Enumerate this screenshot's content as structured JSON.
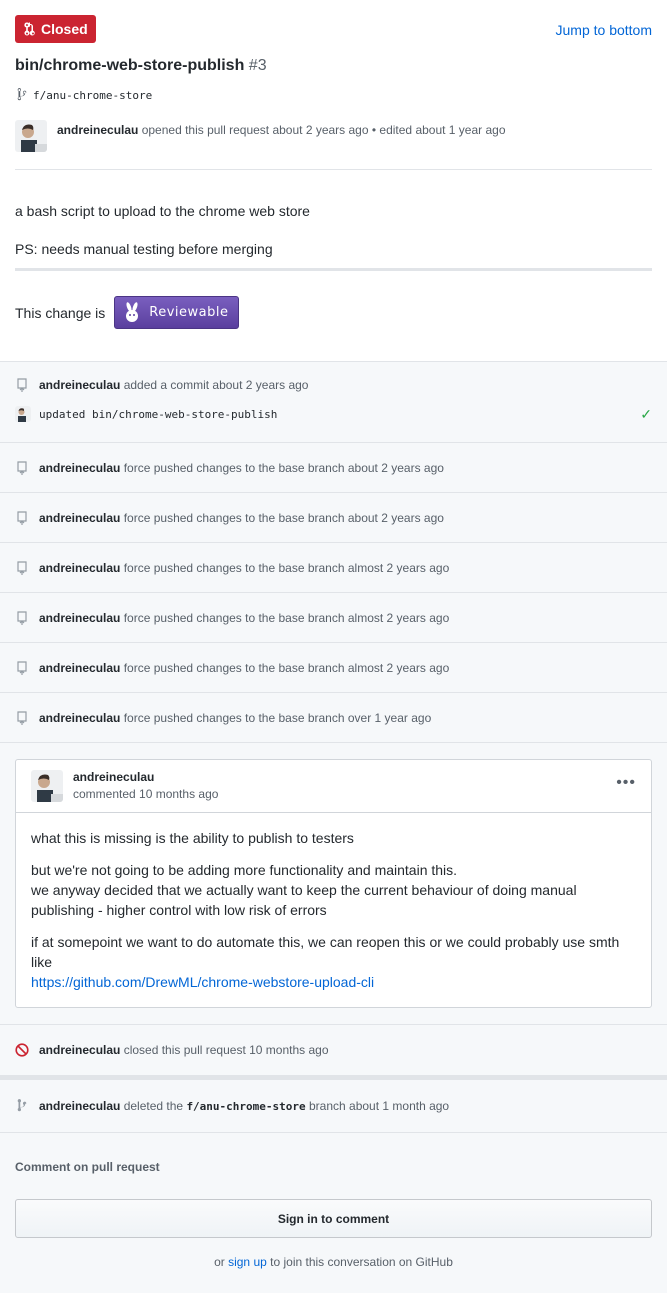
{
  "header": {
    "state_label": "Closed",
    "jump_label": "Jump to bottom",
    "title": "bin/chrome-web-store-publish",
    "number": "#3",
    "branch": "f/anu-chrome-store",
    "author": "andreineculau",
    "opened_text": "opened this pull request about 2 years ago",
    "edited_text": "• edited about 1 year ago"
  },
  "body": {
    "line1": "a bash script to upload to the chrome web store",
    "line2": "PS: needs manual testing before merging",
    "review_prefix": "This change is",
    "reviewable_label": "Reviewable"
  },
  "timeline": {
    "commit_event": {
      "author": "andreineculau",
      "text": "added a commit about 2 years ago",
      "commit_message": "updated bin/chrome-web-store-publish"
    },
    "force_pushes": [
      {
        "author": "andreineculau",
        "text": "force pushed changes to the base branch about 2 years ago"
      },
      {
        "author": "andreineculau",
        "text": "force pushed changes to the base branch about 2 years ago"
      },
      {
        "author": "andreineculau",
        "text": "force pushed changes to the base branch almost 2 years ago"
      },
      {
        "author": "andreineculau",
        "text": "force pushed changes to the base branch almost 2 years ago"
      },
      {
        "author": "andreineculau",
        "text": "force pushed changes to the base branch almost 2 years ago"
      },
      {
        "author": "andreineculau",
        "text": "force pushed changes to the base branch over 1 year ago"
      }
    ],
    "comment": {
      "author": "andreineculau",
      "when": "commented 10 months ago",
      "more": "•••",
      "p1": "what this is missing is the ability to publish to testers",
      "p2a": "but we're not going to be adding more functionality and maintain this.",
      "p2b": "we anyway decided that we actually want to keep the current behaviour of doing manual publishing - higher control with low risk of errors",
      "p3": "if at somepoint we want to do automate this, we can reopen this or we could probably use smth like",
      "link": "https://github.com/DrewML/chrome-webstore-upload-cli"
    },
    "closed_event": {
      "author": "andreineculau",
      "text": "closed this pull request 10 months ago"
    },
    "deleted_event": {
      "author": "andreineculau",
      "text_before": "deleted the",
      "branch": "f/anu-chrome-store",
      "text_after": "branch about 1 month ago"
    }
  },
  "footer": {
    "label": "Comment on pull request",
    "signin_label": "Sign in to comment",
    "hint_before": "or",
    "hint_link": "sign up",
    "hint_after": "to join this conversation on GitHub"
  },
  "colors": {
    "closed_badge": "#cb2431",
    "link": "#0366d6",
    "success": "#28a745"
  }
}
